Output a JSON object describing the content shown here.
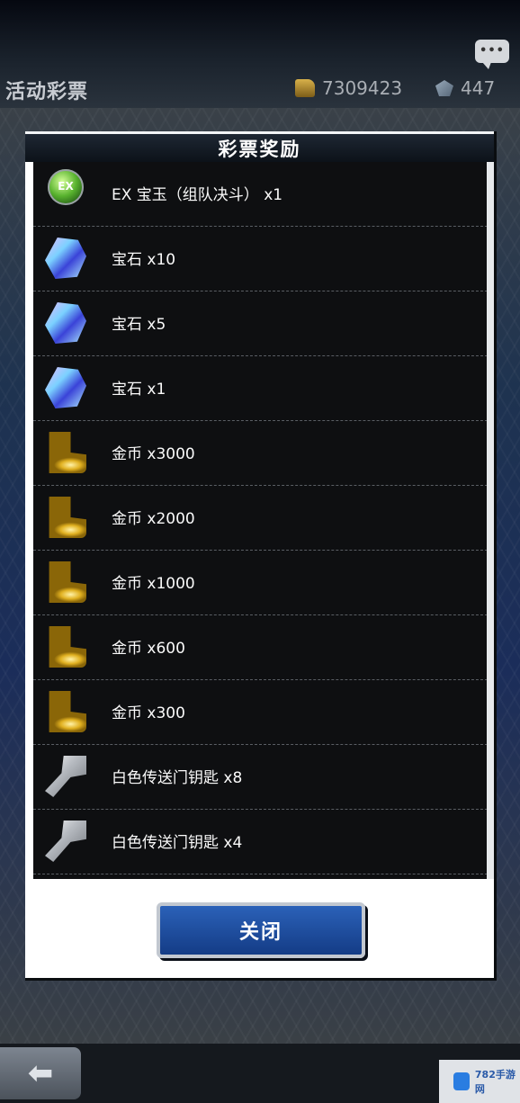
{
  "page": {
    "title": "活动彩票",
    "currency_gold": "7309423",
    "currency_gems": "447"
  },
  "modal": {
    "title": "彩票奖励",
    "close_label": "关闭",
    "items": [
      {
        "label": "EX 宝玉（组队决斗） x1",
        "icon": "ex-orb-icon"
      },
      {
        "label": "宝石 x10",
        "icon": "gem-icon"
      },
      {
        "label": "宝石 x5",
        "icon": "gem-icon"
      },
      {
        "label": "宝石 x1",
        "icon": "gem-icon"
      },
      {
        "label": "金币 x3000",
        "icon": "coin-stack-icon"
      },
      {
        "label": "金币 x2000",
        "icon": "coin-stack-icon"
      },
      {
        "label": "金币 x1000",
        "icon": "coin-stack-icon"
      },
      {
        "label": "金币 x600",
        "icon": "coin-stack-icon"
      },
      {
        "label": "金币 x300",
        "icon": "coin-stack-icon"
      },
      {
        "label": "白色传送门钥匙 x8",
        "icon": "key-icon"
      },
      {
        "label": "白色传送门钥匙 x4",
        "icon": "key-icon"
      }
    ]
  },
  "ex_badge_text": "EX",
  "watermark": "782手游网",
  "colors": {
    "close_button": "#1f4fa0",
    "list_background": "#0e0f11",
    "header_background": "#141c26"
  }
}
